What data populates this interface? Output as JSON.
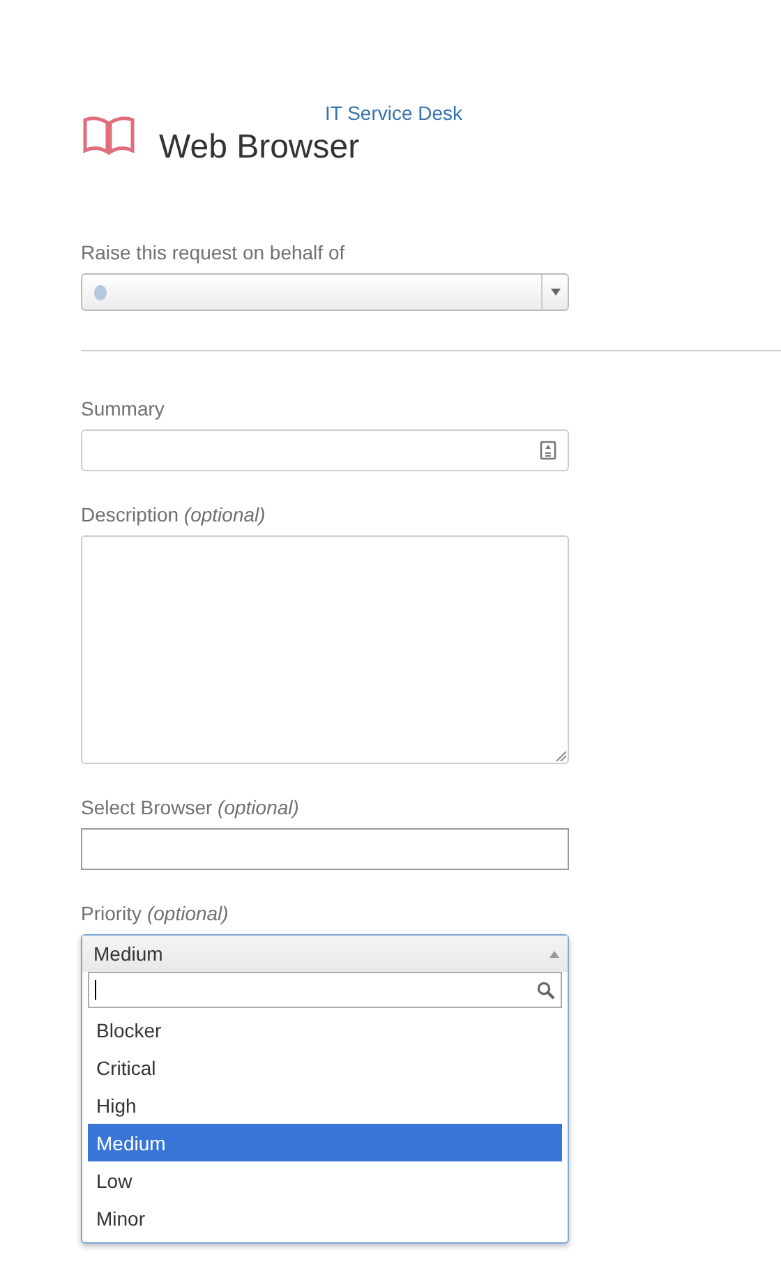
{
  "header": {
    "portal": "IT Service Desk",
    "title": "Web Browser"
  },
  "on_behalf": {
    "label": "Raise this request on behalf of"
  },
  "fields": [
    {
      "kind": "text",
      "label": "Summary"
    },
    {
      "kind": "textarea",
      "label": "Description",
      "optional": "(optional)"
    },
    {
      "kind": "plain",
      "label": "Select Browser",
      "optional": "(optional)"
    }
  ],
  "priority": {
    "label": "Priority",
    "optional": "(optional)",
    "value": "Medium",
    "expanded": true,
    "options": [
      {
        "label": "Blocker",
        "selected": false
      },
      {
        "label": "Critical",
        "selected": false
      },
      {
        "label": "High",
        "selected": false
      },
      {
        "label": "Medium",
        "selected": true
      },
      {
        "label": "Low",
        "selected": false
      },
      {
        "label": "Minor",
        "selected": false
      }
    ]
  }
}
